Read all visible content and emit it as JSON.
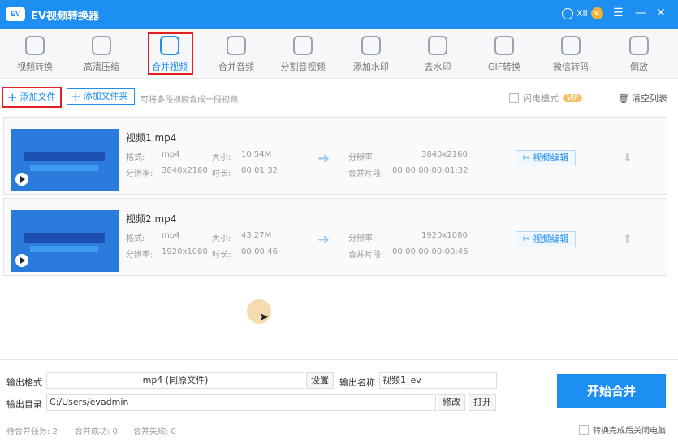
{
  "app": {
    "logo": "EV",
    "title": "EV视频转换器",
    "user": "Xli",
    "vip_badge": "V"
  },
  "tools": [
    {
      "label": "视频转换",
      "icon": "video-convert-icon"
    },
    {
      "label": "高清压缩",
      "icon": "compress-icon"
    },
    {
      "label": "合并视频",
      "icon": "merge-video-icon",
      "active": true
    },
    {
      "label": "合并音频",
      "icon": "merge-audio-icon"
    },
    {
      "label": "分割音视频",
      "icon": "split-icon"
    },
    {
      "label": "添加水印",
      "icon": "stamp-icon"
    },
    {
      "label": "去水印",
      "icon": "remove-watermark-icon"
    },
    {
      "label": "GIF转换",
      "icon": "gif-icon"
    },
    {
      "label": "微信转码",
      "icon": "wechat-icon"
    },
    {
      "label": "倒放",
      "icon": "reverse-icon"
    }
  ],
  "actions": {
    "add_file": "添加文件",
    "add_folder": "添加文件夹",
    "hint": "可将多段视频合成一段视频",
    "flash_mode": "闪电模式",
    "vip": "VIP",
    "clear_list": "清空列表"
  },
  "files": [
    {
      "name": "视频1.mp4",
      "format_label": "格式:",
      "format": "mp4",
      "size_label": "大小:",
      "size": "10.54M",
      "res_label": "分辨率:",
      "res": "3840x2160",
      "dur_label": "时长:",
      "duration": "00:01:32",
      "out_res_label": "分辨率:",
      "out_res": "3840x2160",
      "seg_label": "合并片段:",
      "segment": "00:00:00-00:01:32",
      "edit": "视频编辑",
      "move": "⬇"
    },
    {
      "name": "视频2.mp4",
      "format_label": "格式:",
      "format": "mp4",
      "size_label": "大小:",
      "size": "43.27M",
      "res_label": "分辨率:",
      "res": "1920x1080",
      "dur_label": "时长:",
      "duration": "00:00:46",
      "out_res_label": "分辨率:",
      "out_res": "1920x1080",
      "seg_label": "合并片段:",
      "segment": "00:00:00-00:00:46",
      "edit": "视频编辑",
      "move": "⬆"
    }
  ],
  "bottom": {
    "out_format_label": "输出格式",
    "out_format": "mp4 (同原文件)",
    "settings": "设置",
    "out_name_label": "输出名称",
    "out_name": "视频1_ev",
    "out_dir_label": "输出目录",
    "out_dir": "C:/Users/evadmin",
    "modify": "修改",
    "open": "打开",
    "start": "开始合并",
    "pending": "待合并任务: 2",
    "success": "合并成功: 0",
    "failed": "合并失败: 0",
    "shutdown": "转换完成后关闭电脑"
  },
  "colors": {
    "accent": "#1e8ff2",
    "highlight": "#e02020"
  }
}
